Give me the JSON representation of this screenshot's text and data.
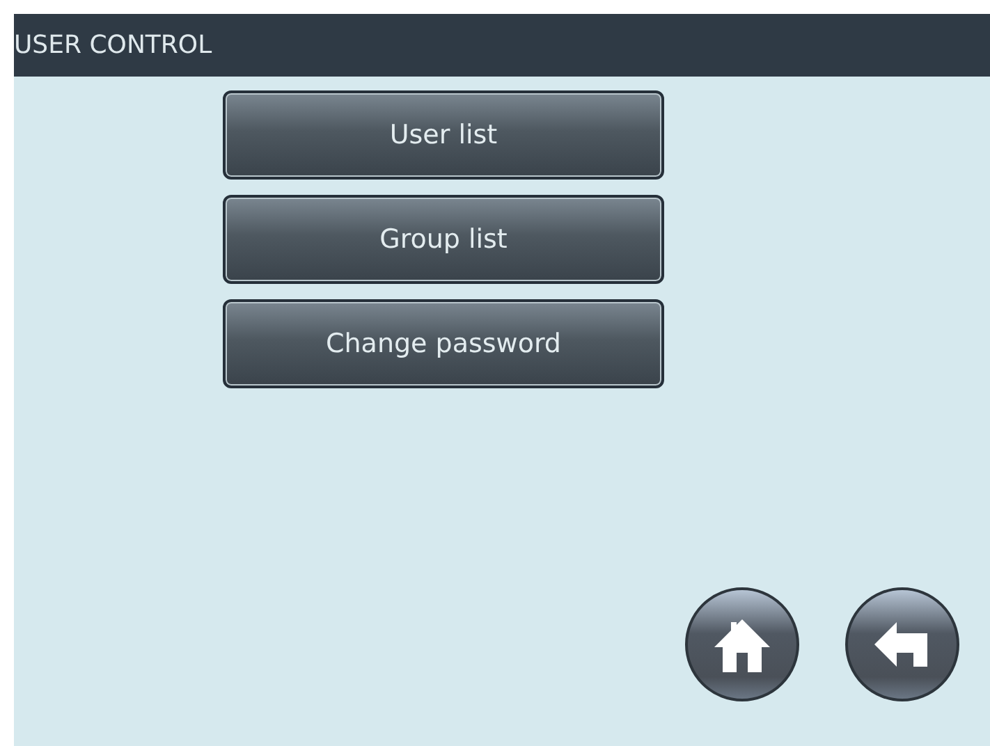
{
  "window": {
    "title": "USER CONTROL"
  },
  "menu_buttons": [
    {
      "label": "User list"
    },
    {
      "label": "Group list"
    },
    {
      "label": "Change password"
    }
  ],
  "nav_buttons": [
    {
      "kind": "home"
    },
    {
      "kind": "back"
    }
  ]
}
